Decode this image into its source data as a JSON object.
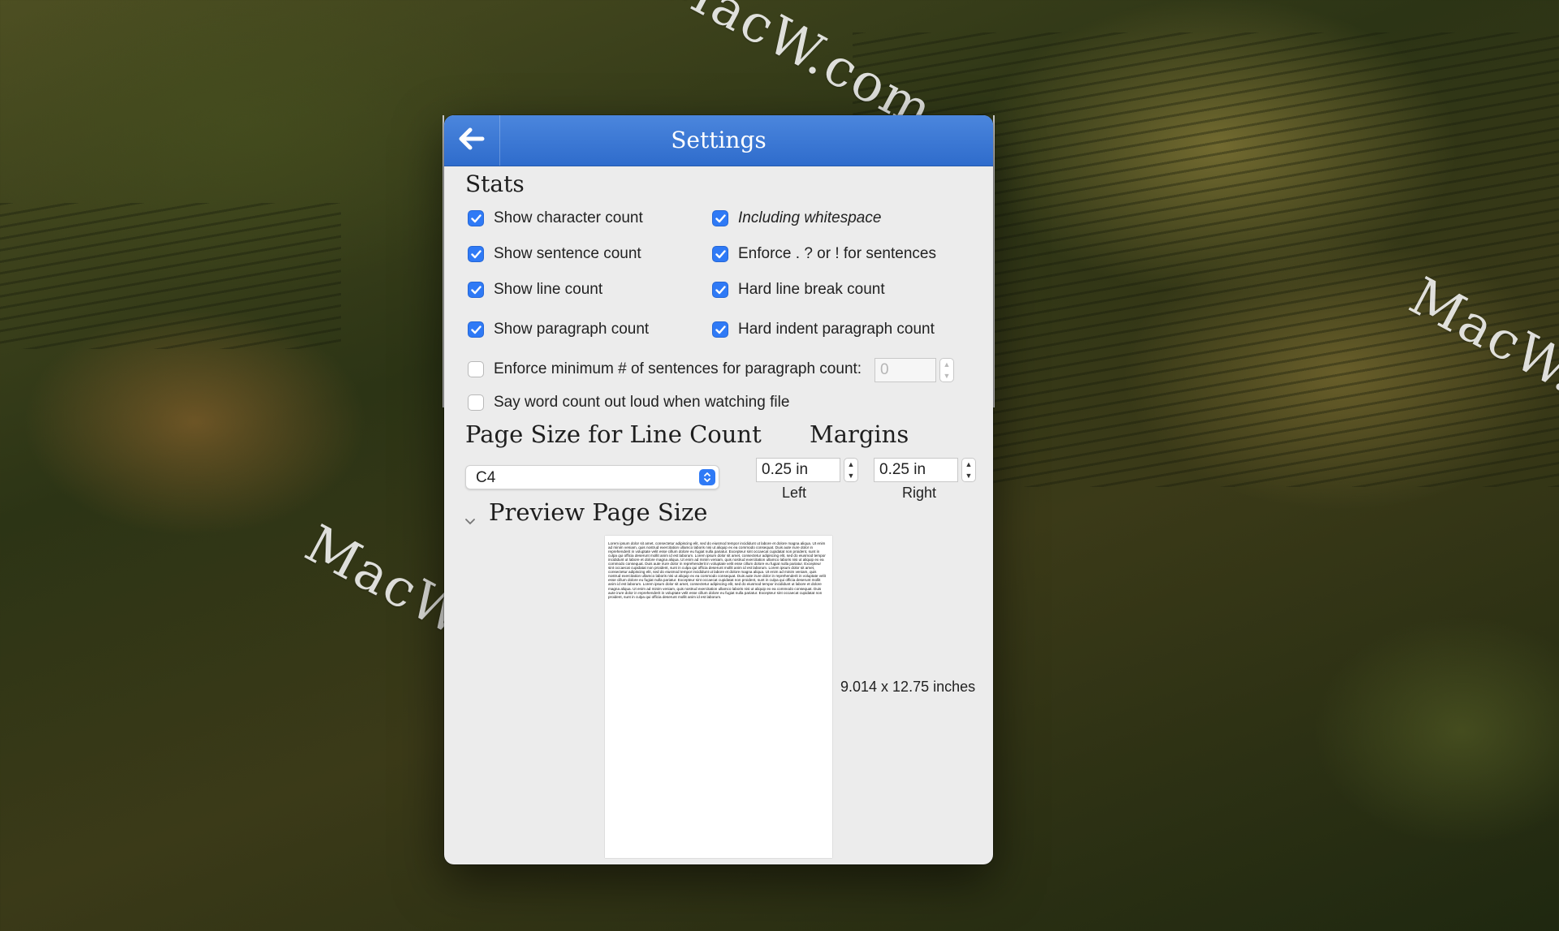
{
  "window": {
    "title": "Settings"
  },
  "watermarks": [
    "MacW.com",
    "MacW.com",
    "MacW.com"
  ],
  "stats": {
    "heading": "Stats",
    "options": [
      {
        "label": "Show character count",
        "checked": true
      },
      {
        "label": "Including whitespace",
        "checked": true
      },
      {
        "label": "Show sentence count",
        "checked": true
      },
      {
        "label": "Enforce . ? or ! for sentences",
        "checked": true
      },
      {
        "label": "Show line count",
        "checked": true
      },
      {
        "label": "Hard line break count",
        "checked": true
      },
      {
        "label": "Show paragraph count",
        "checked": true
      },
      {
        "label": "Hard indent paragraph count",
        "checked": true
      },
      {
        "label": "Enforce minimum # of sentences for paragraph count:",
        "checked": false
      },
      {
        "label": "Say word count out loud when watching file",
        "checked": false
      }
    ],
    "min_sentences_value": "0"
  },
  "page_size": {
    "heading": "Page Size for Line Count",
    "selected": "C4"
  },
  "margins": {
    "heading": "Margins",
    "left_value": "0.25 in",
    "left_label": "Left",
    "right_value": "0.25 in",
    "right_label": "Right"
  },
  "preview": {
    "heading": "Preview Page Size",
    "dimensions": "9.014 x 12.75 inches",
    "sample_text": "Lorem ipsum dolor sit amet, consectetur adipiscing elit, sed do eiusmod tempor incididunt ut labore et dolore magna aliqua. Ut enim ad minim veniam, quis nostrud exercitation ullamco laboris nisi ut aliquip ex ea commodo consequat. Duis aute irure dolor in reprehenderit in voluptate velit esse cillum dolore eu fugiat nulla pariatur. Excepteur sint occaecat cupidatat non proident, sunt in culpa qui officia deserunt mollit anim id est laborum. Lorem ipsum dolor sit amet, consectetur adipiscing elit, sed do eiusmod tempor incididunt ut labore et dolore magna aliqua. Ut enim ad minim veniam, quis nostrud exercitation ullamco laboris nisi ut aliquip ex ea commodo consequat. Duis aute irure dolor in reprehenderit in voluptate velit esse cillum dolore eu fugiat nulla pariatur. Excepteur sint occaecat cupidatat non proident, sunt in culpa qui officia deserunt mollit anim id est laborum. Lorem ipsum dolor sit amet, consectetur adipiscing elit, sed do eiusmod tempor incididunt ut labore et dolore magna aliqua. Ut enim ad minim veniam, quis nostrud exercitation ullamco laboris nisi ut aliquip ex ea commodo consequat. Duis aute irure dolor in reprehenderit in voluptate velit esse cillum dolore eu fugiat nulla pariatur. Excepteur sint occaecat cupidatat non proident, sunt in culpa qui officia deserunt mollit anim id est laborum. Lorem ipsum dolor sit amet, consectetur adipiscing elit, sed do eiusmod tempor incididunt ut labore et dolore magna aliqua. Ut enim ad minim veniam, quis nostrud exercitation ullamco laboris nisi ut aliquip ex ea commodo consequat. Duis aute irure dolor in reprehenderit in voluptate velit esse cillum dolore eu fugiat nulla pariatur. Excepteur sint occaecat cupidatat non proident, sunt in culpa qui officia deserunt mollit anim id est laborum."
  },
  "icons": {
    "back": "arrow-left-icon",
    "check": "checkmark-icon",
    "disclosure": "chevron-down-icon",
    "popup": "up-down-chevron-icon",
    "stepper": "stepper-arrows-icon"
  },
  "colors": {
    "titlebar": "#3a77d6",
    "checkbox_on": "#2f7af6",
    "window_bg": "#ececec"
  }
}
